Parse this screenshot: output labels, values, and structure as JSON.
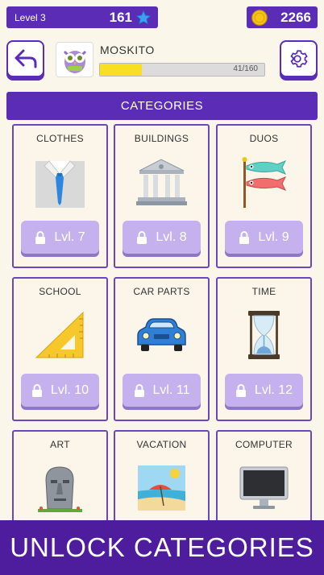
{
  "header": {
    "level_label": "Level 3",
    "stars": "161",
    "coins": "2266"
  },
  "player": {
    "name": "MOSKITO",
    "progress_text": "41/160",
    "progress_fraction": 0.256
  },
  "categories_title": "CATEGORIES",
  "categories": [
    {
      "name": "CLOTHES",
      "lock": "Lvl. 7",
      "icon": "shirt-tie-icon"
    },
    {
      "name": "BUILDINGS",
      "lock": "Lvl. 8",
      "icon": "bank-building-icon"
    },
    {
      "name": "DUOS",
      "lock": "Lvl. 9",
      "icon": "carp-streamers-icon"
    },
    {
      "name": "SCHOOL",
      "lock": "Lvl. 10",
      "icon": "set-square-icon"
    },
    {
      "name": "CAR PARTS",
      "lock": "Lvl. 11",
      "icon": "car-icon"
    },
    {
      "name": "TIME",
      "lock": "Lvl. 12",
      "icon": "hourglass-icon"
    },
    {
      "name": "ART",
      "lock": "",
      "icon": "moai-icon"
    },
    {
      "name": "VACATION",
      "lock": "",
      "icon": "beach-umbrella-icon"
    },
    {
      "name": "COMPUTER",
      "lock": "",
      "icon": "desktop-computer-icon"
    }
  ],
  "banner_text": "UNLOCK CATEGORIES",
  "colors": {
    "purple": "#5b2db7",
    "banner": "#4d1d9e",
    "lock_button": "#c4b1ee",
    "progress": "#f8e020",
    "background": "#faf6ea"
  }
}
